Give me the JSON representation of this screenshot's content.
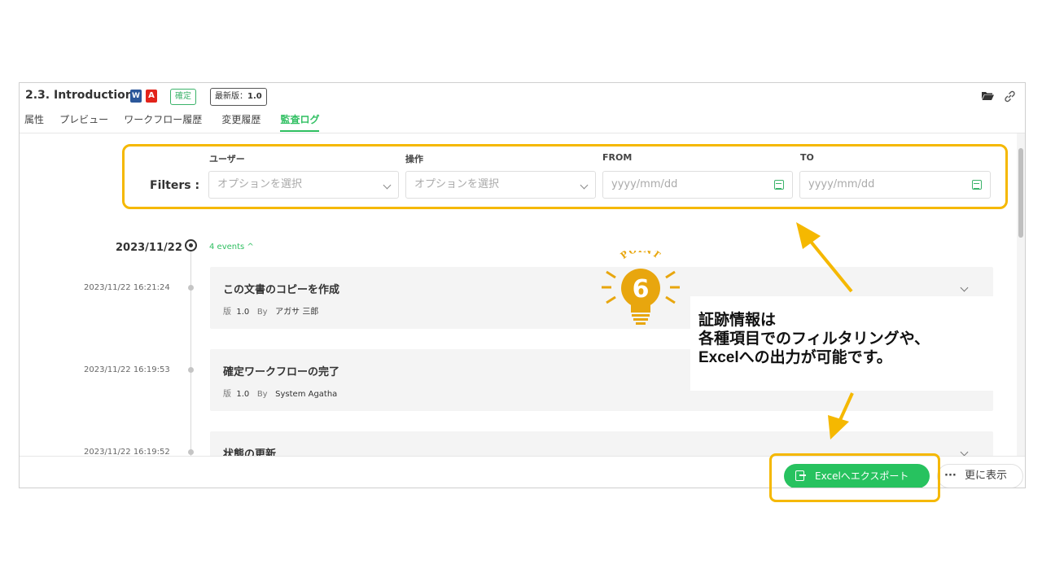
{
  "document": {
    "title": "2.3. Introduction",
    "status_badge": "確定",
    "version_label": "最新版：",
    "version_value": "1.0"
  },
  "tabs": [
    {
      "label": "属性"
    },
    {
      "label": "プレビュー"
    },
    {
      "label": "ワークフロー履歴"
    },
    {
      "label": "変更履歴"
    },
    {
      "label": "監査ログ",
      "active": true
    }
  ],
  "filters": {
    "label": "Filters :",
    "user": {
      "header": "ユーザー",
      "placeholder": "オプションを選択"
    },
    "operation": {
      "header": "操作",
      "placeholder": "オプションを選択"
    },
    "from": {
      "header": "FROM",
      "placeholder": "yyyy/mm/dd"
    },
    "to": {
      "header": "TO",
      "placeholder": "yyyy/mm/dd"
    }
  },
  "timeline": {
    "date": "2023/11/22",
    "events_toggle": "4 events ^",
    "events": [
      {
        "time": "2023/11/22 16:21:24",
        "title": "この文書のコピーを作成",
        "version_label": "版",
        "version": "1.0",
        "by_label": "By",
        "user": "アガサ 三郎"
      },
      {
        "time": "2023/11/22 16:19:53",
        "title": "確定ワークフローの完了",
        "version_label": "版",
        "version": "1.0",
        "by_label": "By",
        "user": "System Agatha"
      },
      {
        "time": "2023/11/22 16:19:52",
        "title": "状態の更新"
      }
    ]
  },
  "footer": {
    "export_label": "Excelへエクスポート",
    "more_dots": "···",
    "more_label": "更に表示"
  },
  "annotation": {
    "point_word": "POINT",
    "point_number": "6",
    "callout_lines": [
      "証跡情報は",
      "各種項目でのフィルタリングや、",
      "Excelへの出力が可能です。"
    ],
    "highlight_color": "#f5b800"
  },
  "icons": {
    "word": "W",
    "pdf": "A"
  },
  "colors": {
    "accent_green": "#27c25f",
    "word_blue": "#2b579a",
    "pdf_red": "#e2231a"
  }
}
